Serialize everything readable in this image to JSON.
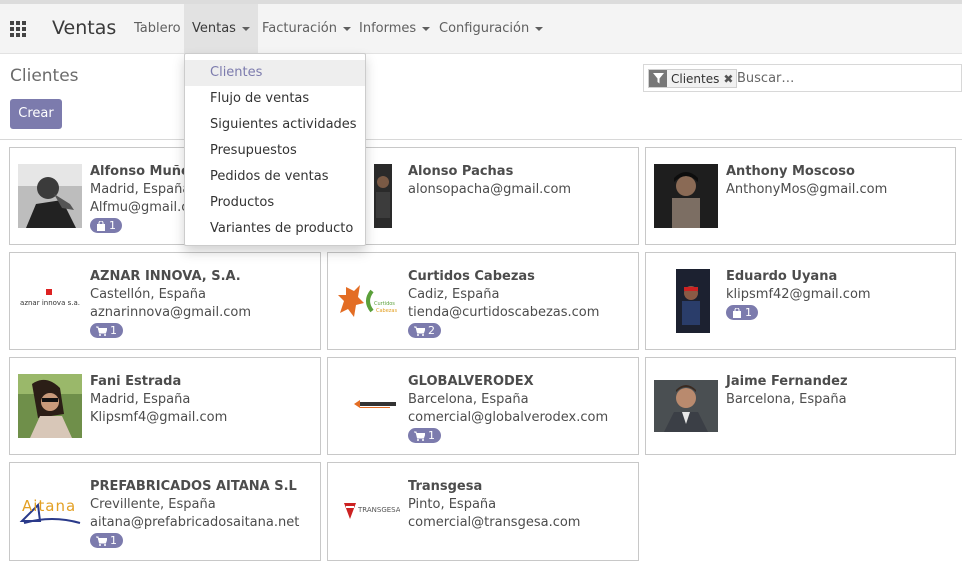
{
  "navbar": {
    "brand": "Ventas",
    "menu": [
      {
        "label": "Tablero"
      },
      {
        "label": "Ventas"
      },
      {
        "label": "Facturación"
      },
      {
        "label": "Informes"
      },
      {
        "label": "Configuración"
      }
    ]
  },
  "control_panel": {
    "title": "Clientes",
    "create_label": "Crear",
    "search": {
      "facet_label": "Clientes",
      "facet_remove": "✖",
      "placeholder": "Buscar…"
    }
  },
  "dropdown": {
    "items": [
      {
        "label": "Clientes"
      },
      {
        "label": "Flujo de ventas"
      },
      {
        "label": "Siguientes actividades"
      },
      {
        "label": "Presupuestos"
      },
      {
        "label": "Pedidos de ventas"
      },
      {
        "label": "Productos"
      },
      {
        "label": "Variantes de producto"
      }
    ]
  },
  "customers": [
    {
      "name": "Alfonso Muñez",
      "lines": [
        "Madrid, España",
        "Alfmu@gmail.com"
      ],
      "badge": "1",
      "badge_icon": "shopping-bag-icon"
    },
    {
      "name": "Alonso Pachas",
      "lines": [
        "alonsopacha@gmail.com"
      ]
    },
    {
      "name": "Anthony Moscoso",
      "lines": [
        "AnthonyMos@gmail.com"
      ]
    },
    {
      "name": "AZNAR INNOVA, S.A.",
      "lines": [
        "Castellón, España",
        "aznarinnova@gmail.com"
      ],
      "badge": "1",
      "badge_icon": "cart-icon",
      "logo_text": "aznar innova s.a."
    },
    {
      "name": "Curtidos Cabezas",
      "lines": [
        "Cadiz, España",
        "tienda@curtidoscabezas.com"
      ],
      "badge": "2",
      "badge_icon": "cart-icon"
    },
    {
      "name": "Eduardo Uyana",
      "lines": [
        "klipsmf42@gmail.com"
      ],
      "badge": "1",
      "badge_icon": "shopping-bag-icon"
    },
    {
      "name": "Fani Estrada",
      "lines": [
        "Madrid, España",
        "Klipsmf4@gmail.com"
      ]
    },
    {
      "name": "GLOBALVERODEX",
      "lines": [
        "Barcelona, España",
        "comercial@globalverodex.com"
      ],
      "badge": "1",
      "badge_icon": "cart-icon"
    },
    {
      "name": "Jaime Fernandez",
      "lines": [
        "Barcelona, España"
      ]
    },
    {
      "name": "PREFABRICADOS AITANA S.L",
      "lines": [
        "Crevillente, España",
        "aitana@prefabricadosaitana.net"
      ],
      "badge": "1",
      "badge_icon": "cart-icon",
      "logo_text": "Aitana"
    },
    {
      "name": "Transgesa",
      "lines": [
        "Pinto, España",
        "comercial@transgesa.com"
      ],
      "logo_text": "TRANSGESA"
    }
  ],
  "colors": {
    "accent": "#7c7bad"
  }
}
